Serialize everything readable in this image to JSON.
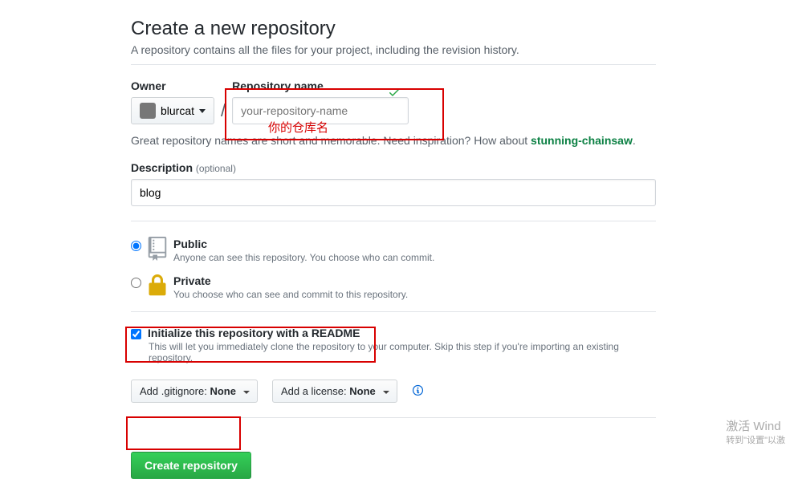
{
  "header": {
    "title": "Create a new repository",
    "subtitle": "A repository contains all the files for your project, including the revision history."
  },
  "owner": {
    "label": "Owner",
    "username": "blurcat"
  },
  "repo": {
    "label": "Repository name",
    "placeholder": "your-repository-name",
    "value": "",
    "annotation": "你的仓库名"
  },
  "hint": {
    "prefix": "Great repository names are short and memorable. Need inspiration? How about ",
    "suggestion": "stunning-chainsaw"
  },
  "description": {
    "label": "Description",
    "optional": "(optional)",
    "value": "blog"
  },
  "visibility": {
    "public": {
      "title": "Public",
      "sub": "Anyone can see this repository. You choose who can commit.",
      "selected": true
    },
    "private": {
      "title": "Private",
      "sub": "You choose who can see and commit to this repository.",
      "selected": false
    }
  },
  "initialize": {
    "label": "Initialize this repository with a README",
    "sub": "This will let you immediately clone the repository to your computer. Skip this step if you're importing an existing repository.",
    "checked": true
  },
  "dropdowns": {
    "gitignore_prefix": "Add .gitignore: ",
    "gitignore_value": "None",
    "license_prefix": "Add a license: ",
    "license_value": "None"
  },
  "submit": {
    "label": "Create repository"
  },
  "watermark": {
    "line1": "激活 Wind",
    "line2": "转到\"设置\"以激"
  }
}
